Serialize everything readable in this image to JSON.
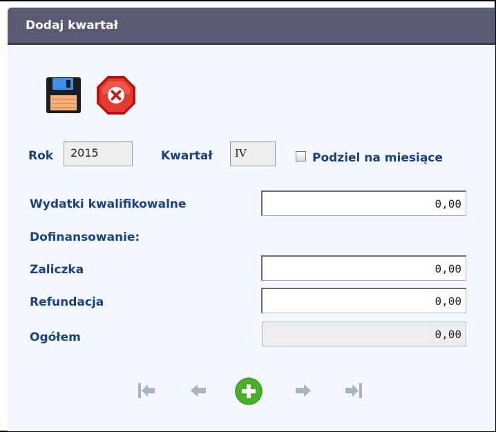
{
  "header": {
    "title": "Dodaj kwartał"
  },
  "toolbar": {
    "save_icon": "floppy-disk-icon",
    "cancel_icon": "red-stop-x-icon"
  },
  "form": {
    "year_label": "Rok",
    "year_value": "2015",
    "quarter_label": "Kwartał",
    "quarter_value": "IV",
    "split_checkbox_label": "Podziel na miesiące",
    "split_checked": false,
    "eligible_label": "Wydatki kwalifikowalne",
    "eligible_value": "0,00",
    "funding_heading": "Dofinansowanie:",
    "advance_label": "Zaliczka",
    "advance_value": "0,00",
    "refund_label": "Refundacja",
    "refund_value": "0,00",
    "total_label": "Ogółem",
    "total_value": "0,00"
  },
  "navigation": {
    "icons": [
      "first-icon",
      "previous-icon",
      "add-icon",
      "next-icon",
      "last-icon"
    ],
    "add_color": "#4caf2a",
    "disabled_color": "#aab4c0"
  },
  "colors": {
    "header_bg": "#5a5a72",
    "label_text": "#1c3f86",
    "panel_bg": "#f2f8fd"
  }
}
